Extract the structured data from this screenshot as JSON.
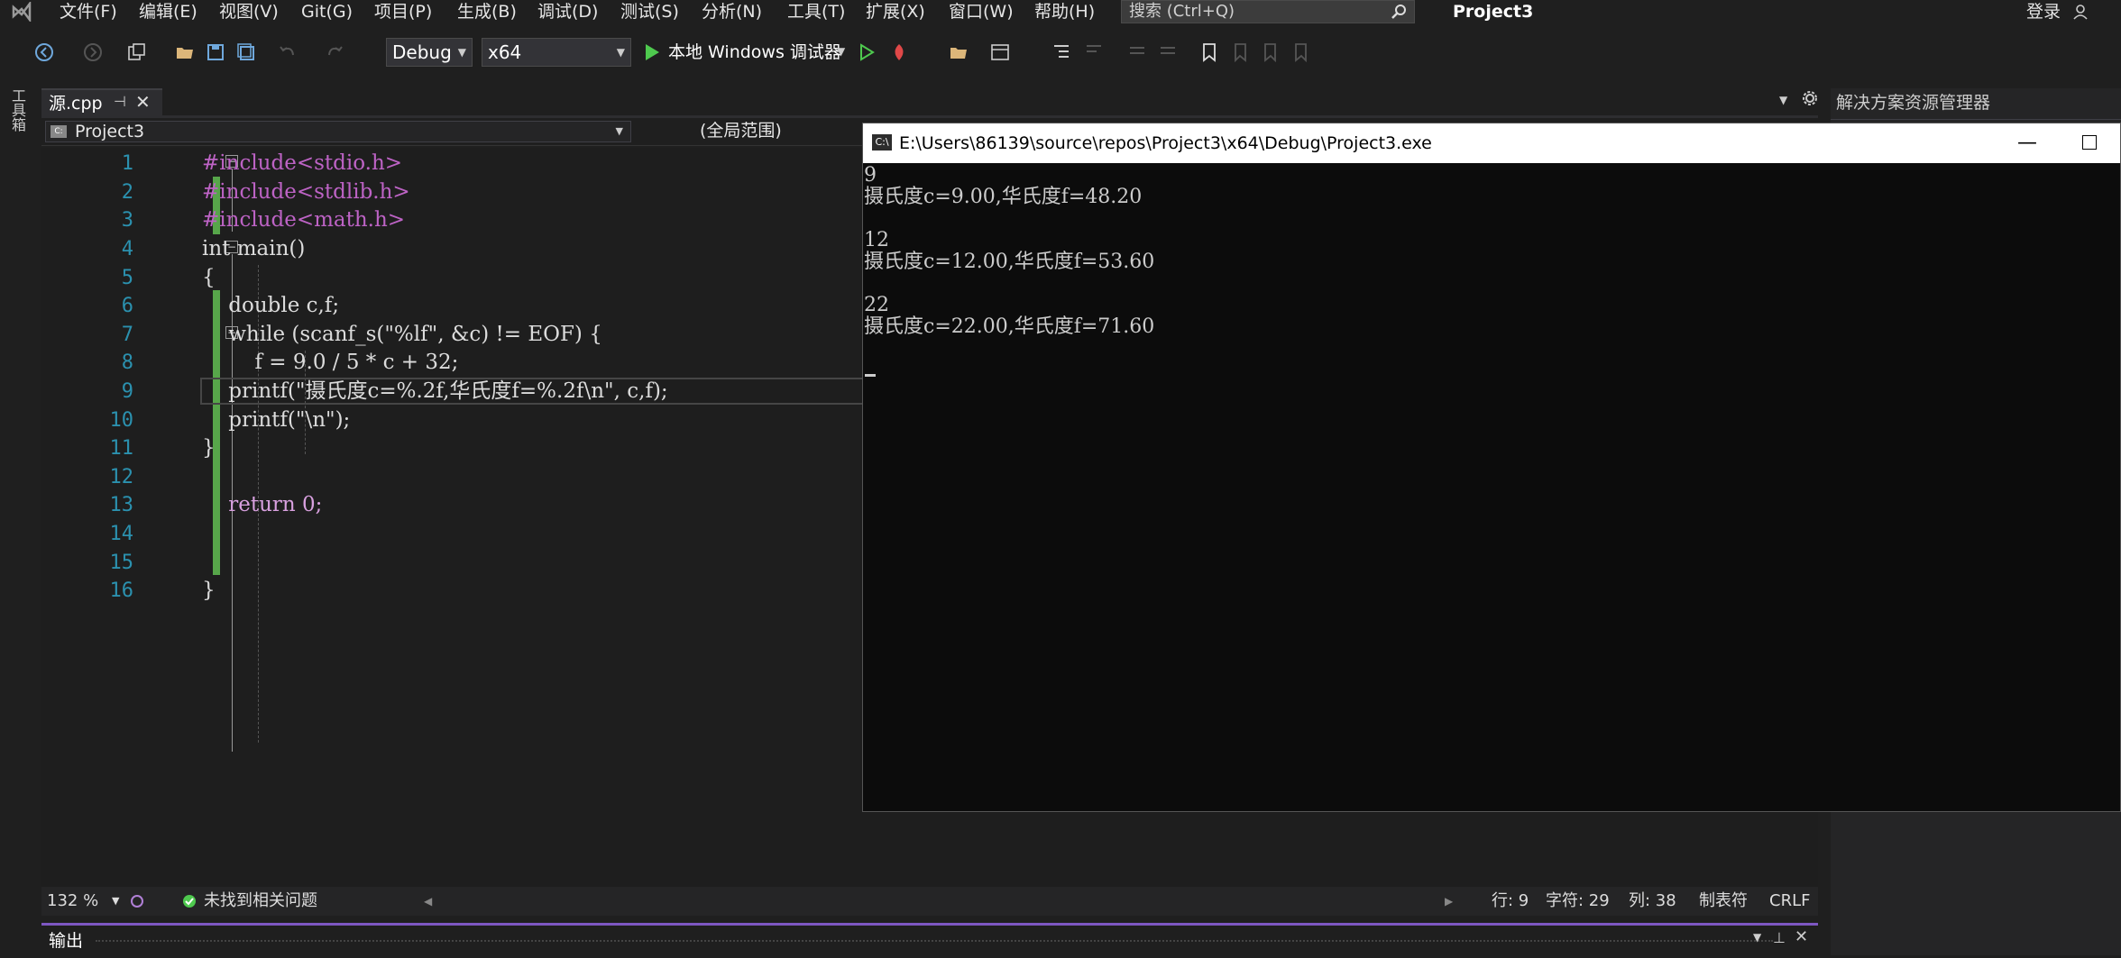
{
  "menu": [
    "文件(F)",
    "编辑(E)",
    "视图(V)",
    "Git(G)",
    "项目(P)",
    "生成(B)",
    "调试(D)",
    "测试(S)",
    "分析(N)",
    "工具(T)",
    "扩展(X)",
    "窗口(W)",
    "帮助(H)"
  ],
  "search": {
    "placeholder": "搜索 (Ctrl+Q)"
  },
  "window_title": "Project3",
  "login_label": "登录",
  "toolbar": {
    "config": "Debug",
    "platform": "x64",
    "run_label": "本地 Windows 调试器"
  },
  "toolbox_label": "工具箱",
  "tab": {
    "label": "源.cpp"
  },
  "nav": {
    "project": "Project3",
    "scope": "(全局范围)"
  },
  "code": {
    "line_numbers": [
      "1",
      "2",
      "3",
      "4",
      "5",
      "6",
      "7",
      "8",
      "9",
      "10",
      "11",
      "12",
      "13",
      "14",
      "15",
      "16"
    ],
    "lines": [
      "#include<stdio.h>",
      "#include<stdlib.h>",
      "#include<math.h>",
      "int main()",
      "{",
      "    double c,f;",
      "    while (scanf_s(\"%lf\", &c) != EOF) {",
      "        f = 9.0 / 5 * c + 32;",
      "    printf(\"摄氏度c=%.2f,华氏度f=%.2f\\n\", c,f);",
      "    printf(\"\\n\");",
      "}",
      "",
      "    return 0;",
      "",
      "",
      "}"
    ]
  },
  "console": {
    "title": "E:\\Users\\86139\\source\\repos\\Project3\\x64\\Debug\\Project3.exe",
    "icon_label": "C:\\",
    "output": [
      "9",
      "摄氏度c=9.00,华氏度f=48.20",
      "",
      "12",
      "摄氏度c=12.00,华氏度f=53.60",
      "",
      "22",
      "摄氏度c=22.00,华氏度f=71.60"
    ]
  },
  "solution_explorer": {
    "title": "解决方案资源管理器"
  },
  "status": {
    "zoom": "132 %",
    "issues": "未找到相关问题",
    "line": "行: 9",
    "char": "字符: 29",
    "col": "列: 38",
    "tabs": "制表符",
    "eol": "CRLF"
  },
  "output_panel": {
    "label": "输出"
  },
  "colors": {
    "keyword": "#569cd6",
    "control": "#d8a0df",
    "string": "#d69d85",
    "number": "#b5cea8",
    "line_number": "#2b91af",
    "change_bar": "#57a64a"
  }
}
